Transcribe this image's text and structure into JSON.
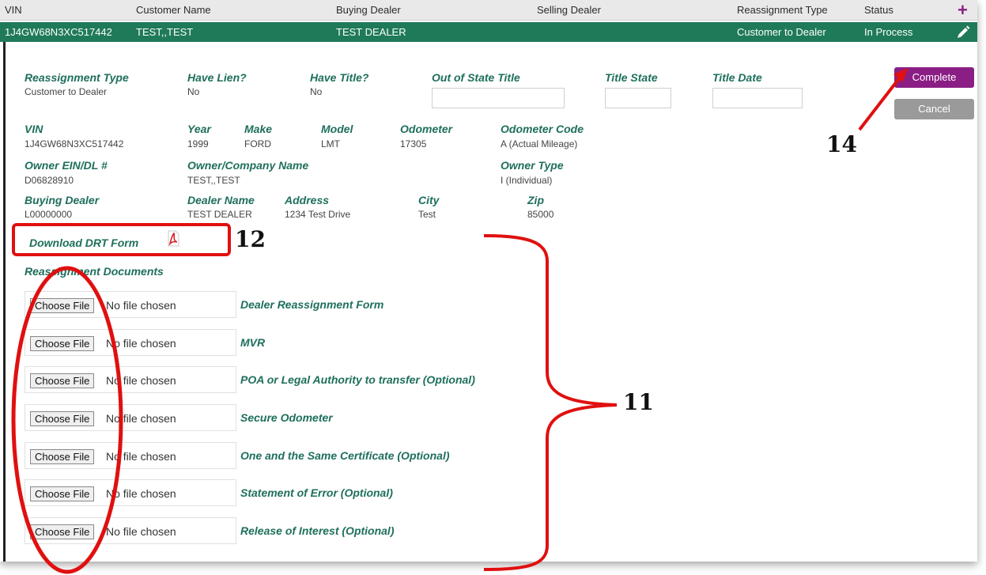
{
  "header": {
    "columns": [
      "VIN",
      "Customer Name",
      "Buying Dealer",
      "Selling Dealer",
      "Reassignment Type",
      "Status"
    ],
    "add_icon": "plus-icon"
  },
  "row": {
    "vin": "1J4GW68N3XC517442",
    "customer_name": "TEST,,TEST",
    "buying_dealer": "TEST DEALER",
    "reassignment_type": "Customer to Dealer",
    "status": "In Process",
    "edit_icon": "pencil-icon"
  },
  "details": {
    "reassignment_type": {
      "label": "Reassignment Type",
      "value": "Customer to Dealer"
    },
    "have_lien": {
      "label": "Have Lien?",
      "value": "No"
    },
    "have_title": {
      "label": "Have Title?",
      "value": "No"
    },
    "out_of_state_title": {
      "label": "Out of State Title",
      "value": ""
    },
    "title_state": {
      "label": "Title State",
      "value": ""
    },
    "title_date": {
      "label": "Title Date",
      "value": ""
    },
    "vin": {
      "label": "VIN",
      "value": "1J4GW68N3XC517442"
    },
    "year": {
      "label": "Year",
      "value": "1999"
    },
    "make": {
      "label": "Make",
      "value": "FORD"
    },
    "model": {
      "label": "Model",
      "value": "LMT"
    },
    "odometer": {
      "label": "Odometer",
      "value": "17305"
    },
    "odometer_code": {
      "label": "Odometer Code",
      "value": "A (Actual Mileage)"
    },
    "owner_ein": {
      "label": "Owner EIN/DL #",
      "value": "D06828910"
    },
    "owner_name": {
      "label": "Owner/Company Name",
      "value": "TEST,,TEST"
    },
    "owner_type": {
      "label": "Owner Type",
      "value": "I (Individual)"
    },
    "buying_dealer": {
      "label": "Buying Dealer",
      "value": "L00000000"
    },
    "dealer_name": {
      "label": "Dealer Name",
      "value": "TEST DEALER"
    },
    "address": {
      "label": "Address",
      "value": "1234 Test Drive"
    },
    "city": {
      "label": "City",
      "value": "Test"
    },
    "zip": {
      "label": "Zip",
      "value": "85000"
    }
  },
  "actions": {
    "complete": "Complete",
    "cancel": "Cancel"
  },
  "download": {
    "label": "Download DRT Form",
    "icon": "pdf-icon"
  },
  "documents": {
    "title": "Reassignment Documents",
    "choose_label": "Choose File",
    "no_file": "No file chosen",
    "items": [
      "Dealer Reassignment Form",
      "MVR",
      "POA or Legal Authority to transfer (Optional)",
      "Secure Odometer",
      "One and the Same Certificate (Optional)",
      "Statement of Error (Optional)",
      "Release of Interest (Optional)"
    ]
  },
  "callouts": {
    "c11": "11",
    "c12": "12",
    "c14": "14"
  },
  "colors": {
    "accent_green": "#1f7a5a",
    "label_green": "#1e6f5c",
    "complete_purple": "#8b1e84",
    "annotation_red": "#e01010"
  }
}
